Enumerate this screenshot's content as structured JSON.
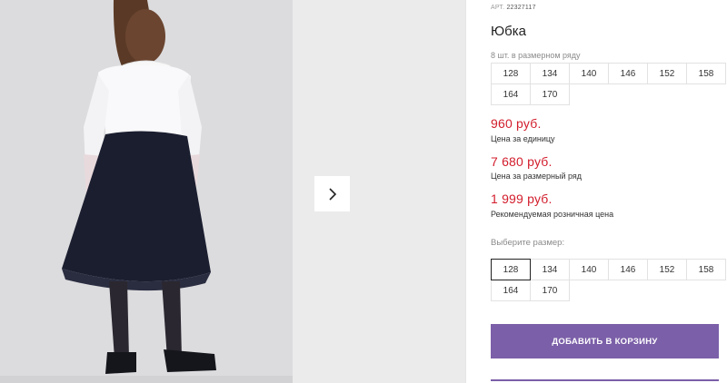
{
  "product": {
    "article_label": "АРТ.",
    "article_code": "22327117",
    "title": "Юбка",
    "pack_info": "8 шт. в размерном ряду",
    "pack_sizes": [
      "128",
      "134",
      "140",
      "146",
      "152",
      "158",
      "164",
      "170"
    ]
  },
  "prices": [
    {
      "value": "960 руб.",
      "note": "Цена за единицу"
    },
    {
      "value": "7 680 руб.",
      "note": "Цена за размерный ряд"
    },
    {
      "value": "1 999 руб.",
      "note": "Рекомендуемая розничная цена"
    }
  ],
  "size_selector": {
    "label": "Выберите размер:",
    "options": [
      "128",
      "134",
      "140",
      "146",
      "152",
      "158",
      "164",
      "170"
    ],
    "selected": "128"
  },
  "cart": {
    "add_label": "ДОБАВИТЬ В КОРЗИНУ"
  },
  "colors": {
    "accent": "#7b5fa8",
    "price": "#d21d2c"
  },
  "icons": {
    "next": "chevron-right-icon"
  }
}
